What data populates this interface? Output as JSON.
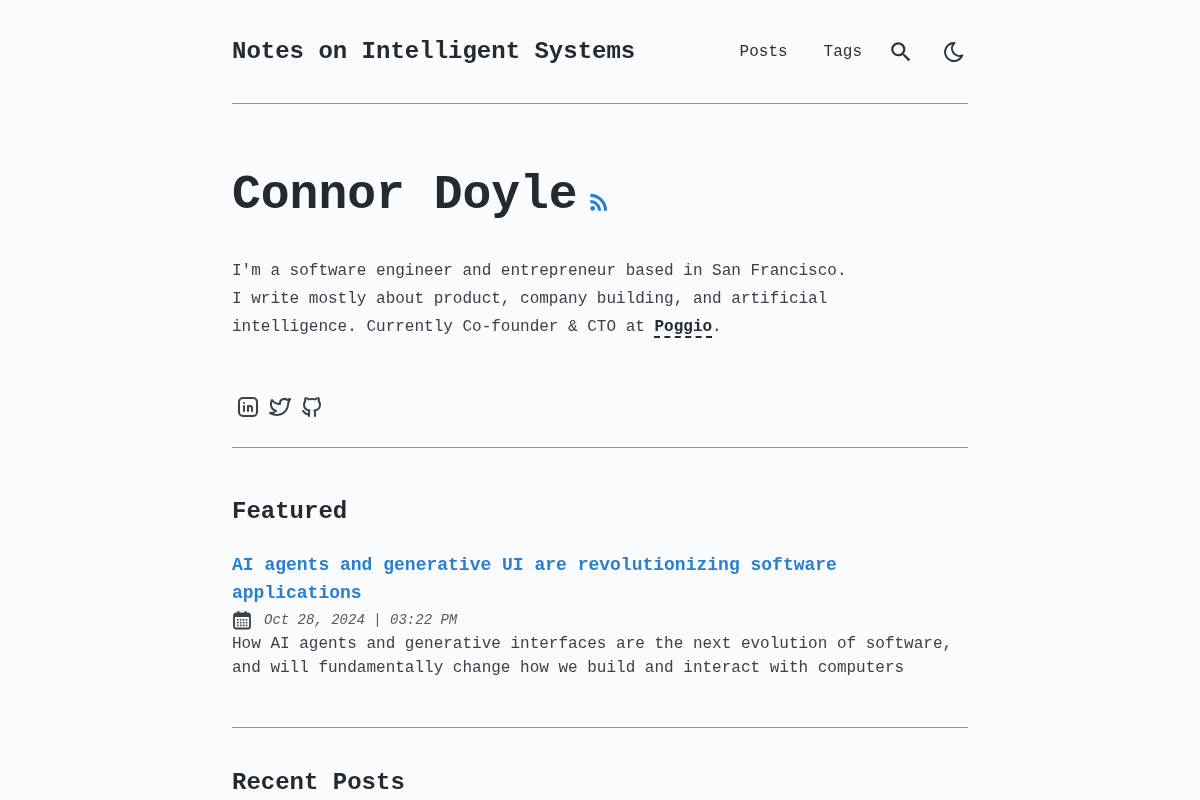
{
  "header": {
    "site_title": "Notes on Intelligent Systems",
    "nav": [
      {
        "label": "Posts"
      },
      {
        "label": "Tags"
      }
    ]
  },
  "profile": {
    "name": "Connor Doyle",
    "bio": {
      "text": "I'm a software engineer and entrepreneur based in San Francisco. I write mostly about product, company building, and artificial intelligence. Currently Co-founder & CTO at ",
      "link": "Poggio",
      "after": "."
    }
  },
  "featured": {
    "heading": "Featured",
    "posts": [
      {
        "title": "AI agents and generative UI are revolutionizing software applications",
        "date": "Oct 28, 2024 | 03:22 PM",
        "description": "How AI agents and generative interfaces are the next evolution of software, and will fundamentally change how we build and interact with computers"
      }
    ]
  },
  "recent": {
    "heading": "Recent Posts"
  }
}
